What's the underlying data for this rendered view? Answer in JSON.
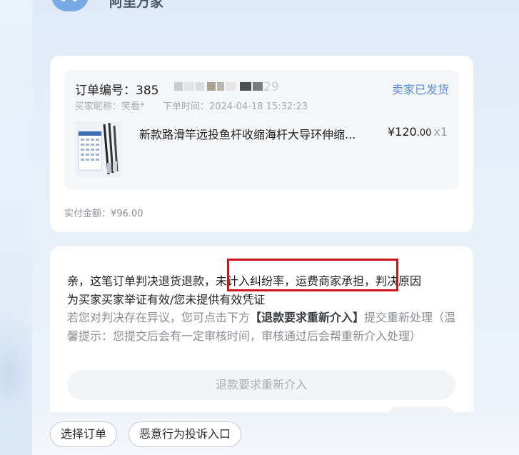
{
  "header": {
    "brand": "阿里万家"
  },
  "order": {
    "number_label": "订单编号：385",
    "number_tail": "29",
    "status": "卖家已发货",
    "buyer": "买家昵称：笑看*",
    "order_time": "下单时间：2024-04-18 15:32:23",
    "product_title": "新款路滑竿远投鱼杆收缩海杆大导环伸缩...",
    "price_main": "¥120",
    "price_decimal": ".00",
    "quantity": "x1",
    "paid_amount": "实付金额：¥96.00"
  },
  "message": {
    "line1_part1": "亲，这笔订单判决退货退款，",
    "line1_highlight": "未计入纠纷率，运费商家承担",
    "line1_part2": "，判决原因",
    "line2": "为买家买家举证有效/您未提供有效凭证",
    "appeal_part1": "若您对判决存在异议，您可点击下方",
    "appeal_bold": "【退款要求重新介入】",
    "appeal_part2": "提交重新处理（温馨提示：您提交后会有一定审核时间，审核通过后会帮重新介入处理）",
    "reappeal_button": "退款要求重新介入"
  },
  "bottom": {
    "select_order": "选择订单",
    "complaint": "恶意行为投诉入口"
  },
  "colors": {
    "accent": "#5b8ed6",
    "highlight_border": "#d0111a",
    "page_bg": "#e9f2fb"
  },
  "icons": [
    "brand-logo-icon",
    "product-thumbnail"
  ]
}
